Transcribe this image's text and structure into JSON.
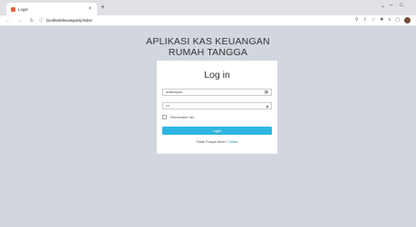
{
  "browser": {
    "tab_title": "Login",
    "tab_close": "×",
    "new_tab": "+",
    "url": "localhost/keuangan/p/index",
    "window_controls": [
      "⌄",
      "–",
      "□"
    ]
  },
  "app": {
    "title_line1": "APLIKASI KAS KEUANGAN",
    "title_line2": "RUMAH TANGGA"
  },
  "login": {
    "heading": "Log in",
    "username_value": "ardiansyah",
    "password_value": "•••",
    "remember_label": "Remember me",
    "submit_label": "Login",
    "register_prompt": "Tidak Punya Akun?",
    "register_link": "Daftar"
  },
  "icons": {
    "username": "card-icon",
    "password": "lock-icon"
  },
  "colors": {
    "page_bg": "#d2d6de",
    "primary_button": "#2fb6e0",
    "link": "#3c8dbc"
  }
}
